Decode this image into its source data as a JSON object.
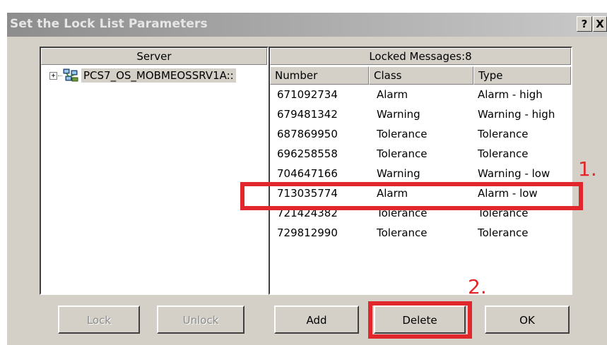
{
  "window": {
    "title": "Set the Lock List Parameters",
    "help_button": "?",
    "close_button": "X"
  },
  "server_panel": {
    "header": "Server",
    "tree": {
      "expander": "+",
      "icon": "server-network-icon",
      "label": "PCS7_OS_MOBMEOSSRV1A::"
    }
  },
  "messages_panel": {
    "header": "Locked Messages:8",
    "columns": [
      "Number",
      "Class",
      "Type"
    ],
    "rows": [
      {
        "number": "671092734",
        "class": "Alarm",
        "type": "Alarm - high"
      },
      {
        "number": "679481342",
        "class": "Warning",
        "type": "Warning - high"
      },
      {
        "number": "687869950",
        "class": "Tolerance",
        "type": "Tolerance"
      },
      {
        "number": "696258558",
        "class": "Tolerance",
        "type": "Tolerance"
      },
      {
        "number": "704647166",
        "class": "Warning",
        "type": "Warning - low"
      },
      {
        "number": "713035774",
        "class": "Alarm",
        "type": "Alarm - low"
      },
      {
        "number": "721424382",
        "class": "Tolerance",
        "type": "Tolerance"
      },
      {
        "number": "729812990",
        "class": "Tolerance",
        "type": "Tolerance"
      }
    ],
    "selected_row_index": 5
  },
  "buttons": {
    "lock": "Lock",
    "unlock": "Unlock",
    "add": "Add",
    "delete": "Delete",
    "ok": "OK"
  },
  "annotations": {
    "step1": "1.",
    "step2": "2.",
    "color": "#e1262c"
  }
}
